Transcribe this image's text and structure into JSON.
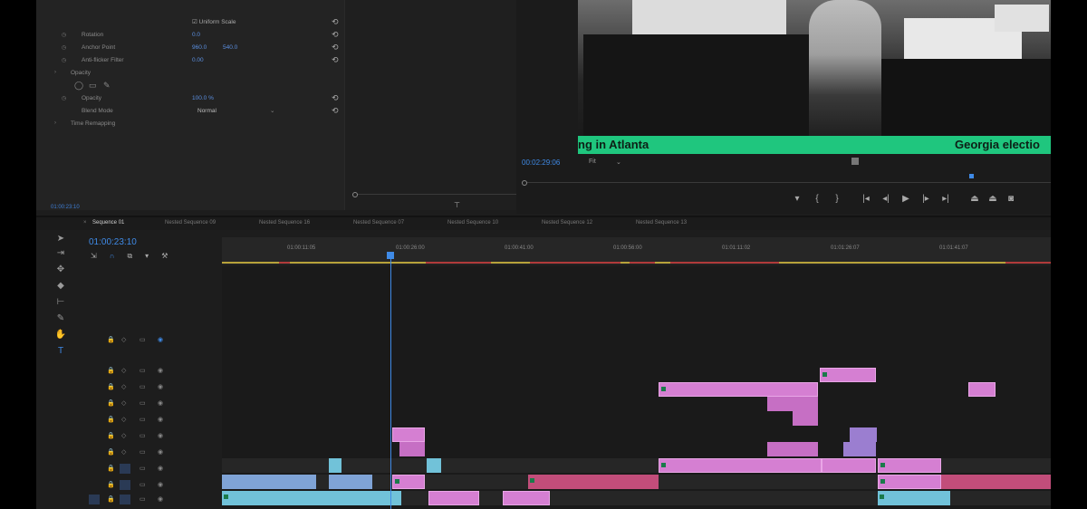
{
  "effect_controls": {
    "rows": [
      {
        "name": "Uniform Scale",
        "value": ""
      },
      {
        "name": "Rotation",
        "value": "0.0"
      },
      {
        "name": "Anchor Point",
        "value": "960.0",
        "value2": "540.0"
      },
      {
        "name": "Anti-flicker Filter",
        "value": "0.00"
      },
      {
        "name": "Opacity",
        "value": ""
      },
      {
        "name": "Opacity",
        "value": "100.0 %"
      },
      {
        "name": "Blend Mode",
        "value": "Normal"
      },
      {
        "name": "Time Remapping",
        "value": ""
      }
    ],
    "timecode": "01:00:23:10"
  },
  "program": {
    "ticker_left": "ng in Atlanta",
    "ticker_right": "Georgia electio",
    "timecode": "00:02:29:06",
    "fit": "Fit"
  },
  "timeline": {
    "tabs": [
      "Sequence 01",
      "Nested Sequence 09",
      "Nested Sequence 16",
      "Nested Sequence 07",
      "Nested Sequence 10",
      "Nested Sequence 12",
      "Nested Sequence 13"
    ],
    "timecode": "01:00:23:10",
    "ruler": [
      "01:00:11:05",
      "01:00:26:00",
      "01:00:41:00",
      "01:00:56:00",
      "01:01:11:02",
      "01:01:26:07",
      "01:01:41:07"
    ]
  },
  "colors": {
    "accent": "#3f8ae6",
    "ticker": "#1fc67e",
    "clip_pink": "#d57fd2"
  }
}
